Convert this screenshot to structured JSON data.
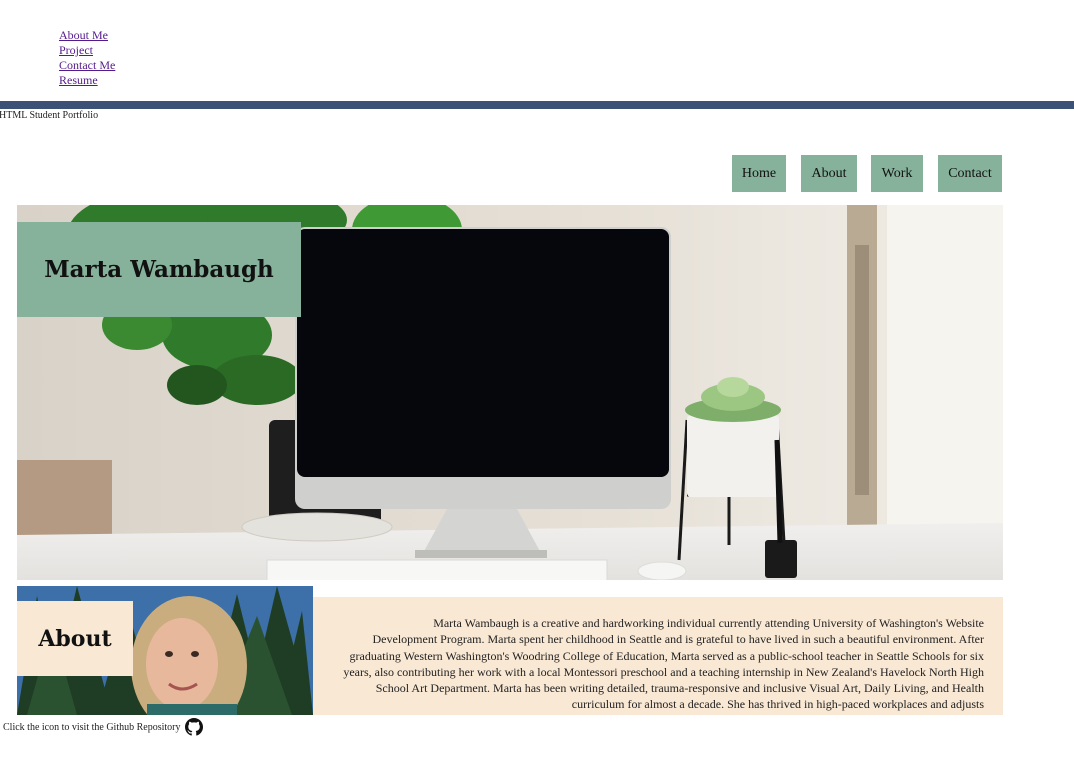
{
  "top_links": [
    "About Me",
    "Project",
    "Contact Me",
    "Resume"
  ],
  "site_label": "HTML Student Portfolio",
  "nav": {
    "items": [
      "Home",
      "About",
      "Work",
      "Contact"
    ]
  },
  "hero": {
    "name": "Marta Wambaugh",
    "image": "desk-with-monitor-and-plants"
  },
  "about": {
    "heading": "About",
    "photo": "portrait-outdoors-trees",
    "text": "Marta Wambaugh is a creative and hardworking individual currently attending University of Washington's Website Development Program. Marta spent her childhood in Seattle and is grateful to have lived in such a beautiful environment. After graduating Western Washington's Woodring College of Education, Marta served as a public-school teacher in Seattle Schools for six years, also contributing her work with a local Montessori preschool and a teaching internship in New Zealand's Havelock North High School Art Department. Marta has been writing detailed, trauma-responsive and inclusive Visual Art, Daily Living, and Health curriculum for almost a decade. She has thrived in high-paced workplaces and adjusts"
  },
  "footer": {
    "note": ", Click the icon to visit the Github Repository",
    "icon": "github-icon"
  },
  "colors": {
    "accent_green": "#86b29b",
    "accent_peach": "#f9e8d4",
    "bar_blue": "#3c5178",
    "link_visited": "#551a8b"
  }
}
